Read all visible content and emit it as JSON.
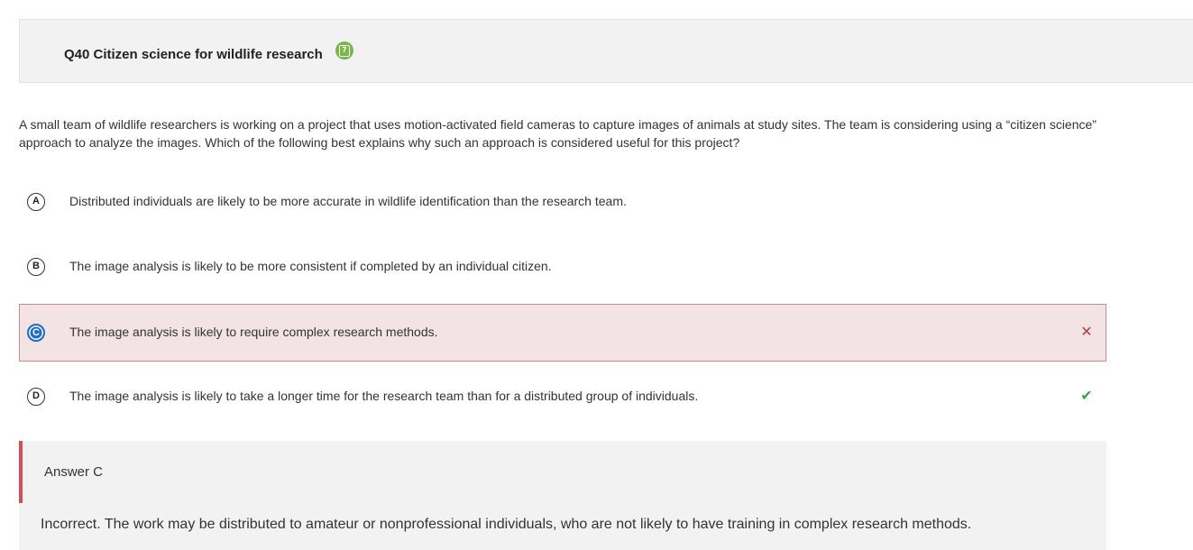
{
  "question": {
    "title": "Q40 Citizen science for wildlife research",
    "help_icon": "question-mark-icon",
    "stem": "A small team of wildlife researchers is working on a project that uses motion-activated field cameras to capture images of animals at study sites. The team is considering using a “citizen science” approach to analyze the images. Which of the following best explains why such an approach is considered useful for this project?"
  },
  "choices": [
    {
      "letter": "A",
      "text": "Distributed individuals are likely to be more accurate in wildlife identification than the research team.",
      "state": "none"
    },
    {
      "letter": "B",
      "text": "The image analysis is likely to be more consistent if completed by an individual citizen.",
      "state": "none"
    },
    {
      "letter": "C",
      "text": "The image analysis is likely to require complex research methods.",
      "state": "selected-incorrect",
      "mark_icon": "cross-icon",
      "mark": "✕"
    },
    {
      "letter": "D",
      "text": "The image analysis is likely to take a longer time for the research team than for a distributed group of individuals.",
      "state": "correct",
      "mark_icon": "check-icon",
      "mark": "✔"
    }
  ],
  "answer": {
    "label": "Answer C",
    "explanation": "Incorrect. The work may be distributed to amateur or nonprofessional individuals, who are not likely to have training in complex research methods."
  },
  "colors": {
    "incorrect_accent": "#d94c5a",
    "selected_badge": "#1f6dc4",
    "correct_mark": "#3ea34a",
    "help_icon": "#7ab648"
  }
}
